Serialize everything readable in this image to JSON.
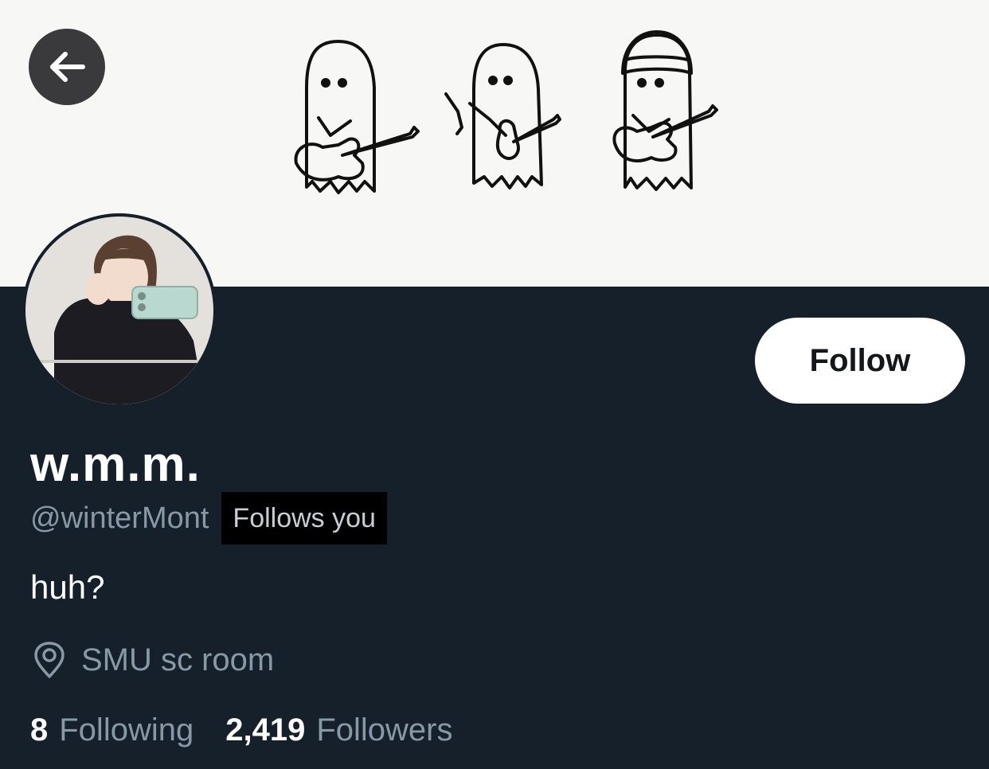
{
  "header": {
    "back_icon": "arrow-left-icon"
  },
  "profile": {
    "display_name": "w.m.m.",
    "handle": "@winterMont",
    "follows_you_badge": "Follows you",
    "bio": "huh?",
    "location": "SMU sc room",
    "location_icon": "location-pin-icon",
    "follow_button_label": "Follow"
  },
  "stats": {
    "following_count": "8",
    "following_label": "Following",
    "followers_count": "2,419",
    "followers_label": "Followers"
  },
  "colors": {
    "background": "#15202b",
    "banner": "#f7f7f5",
    "secondary_text": "#8899a6",
    "primary_text": "#ffffff",
    "follow_button_bg": "#ffffff"
  }
}
